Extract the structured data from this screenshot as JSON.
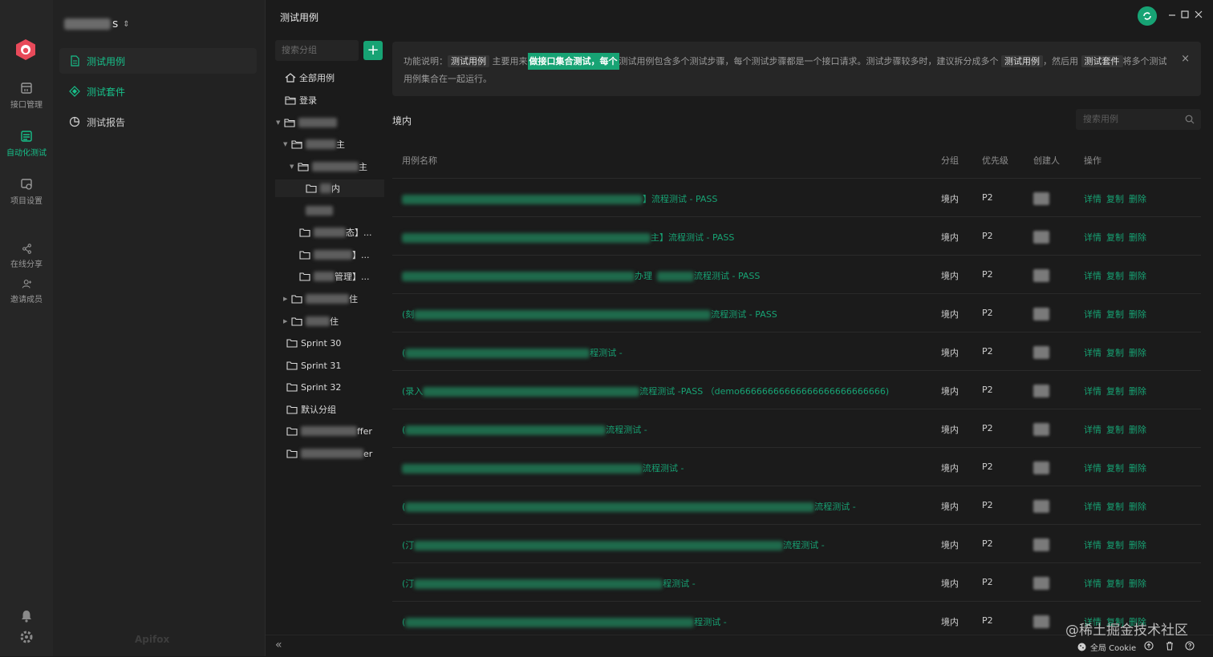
{
  "rail": {
    "items": [
      {
        "label": "接口管理"
      },
      {
        "label": "自动化测试"
      },
      {
        "label": "项目设置"
      },
      {
        "label": "在线分享"
      },
      {
        "label": "邀请成员"
      }
    ]
  },
  "nav": {
    "project_suffix": "s",
    "items": [
      {
        "label": "测试用例"
      },
      {
        "label": "测试套件"
      },
      {
        "label": "测试报告"
      }
    ],
    "footer": "Apifox"
  },
  "header": {
    "title": "测试用例"
  },
  "tree": {
    "search_placeholder": "搜索分组",
    "add_label": "+",
    "all_cases": "全部用例",
    "login": "登录",
    "sprints": [
      "Sprint 30",
      "Sprint 31",
      "Sprint 32"
    ],
    "default_group": "默认分组",
    "partials": {
      "n3": "主",
      "n4": "主",
      "n5": "内",
      "n7": "态】...",
      "n8": "】...",
      "n9": "管理】...",
      "n10": "住",
      "n11": "住",
      "n12": "ffer",
      "n13": "er"
    }
  },
  "tip": {
    "prefix": "功能说明：",
    "tag1": "测试用例",
    "t1": "主要用来",
    "highlight": "做接口集合测试，每个",
    "t2": "测试用例包含多个测试步骤，每个测试步骤都是一个接口请求。测试步骤较多时，建议拆分成多个",
    "tag2": "测试用例",
    "t3": "，然后用",
    "tag3": "测试套件",
    "t4": "将多个测试",
    "line2": "用例集合在一起运行。",
    "close": "×"
  },
  "group_title": "境内",
  "case_search_placeholder": "搜索用例",
  "table": {
    "headers": {
      "name": "用例名称",
      "group": "分组",
      "priority": "优先级",
      "owner": "创建人",
      "ops": "操作"
    },
    "ops": {
      "detail": "详情",
      "copy": "复制",
      "delete": "删除"
    },
    "rows": [
      {
        "prefix": "",
        "tail": "】流程测试 - PASS",
        "group": "境内",
        "priority": "P2"
      },
      {
        "prefix": "",
        "tail": "主】流程测试 - PASS",
        "group": "境内",
        "priority": "P2"
      },
      {
        "prefix": "",
        "tail": "办理",
        "tail2": "流程测试 - PASS",
        "group": "境内",
        "priority": "P2"
      },
      {
        "prefix": "(刻",
        "tail": "流程测试 - PASS",
        "group": "境内",
        "priority": "P2"
      },
      {
        "prefix": "(",
        "tail": "程测试 -",
        "group": "境内",
        "priority": "P2"
      },
      {
        "prefix": "(录入",
        "tail": "流程测试 -PASS （demo66666666666666666666666666)",
        "group": "境内",
        "priority": "P2"
      },
      {
        "prefix": "(",
        "tail": "流程测试 -",
        "group": "境内",
        "priority": "P2"
      },
      {
        "prefix": "",
        "tail": "流程测试 -",
        "group": "境内",
        "priority": "P2"
      },
      {
        "prefix": "(",
        "tail": "流程测试 -",
        "group": "境内",
        "priority": "P2"
      },
      {
        "prefix": "(汀",
        "tail": "流程测试 -",
        "group": "境内",
        "priority": "P2"
      },
      {
        "prefix": "(汀",
        "tail": "程测试 -",
        "group": "境内",
        "priority": "P2"
      },
      {
        "prefix": "(",
        "tail": "程测试 -",
        "group": "境内",
        "priority": "P2"
      }
    ]
  },
  "statusbar": {
    "collapse": "«",
    "cookie": "全局 Cookie"
  },
  "watermark": "@稀土掘金技术社区",
  "colors": {
    "accent": "#17a374",
    "accent_text": "#17c08a",
    "bg": "#1b1b1b",
    "sidebar": "#222222",
    "rail": "#262626"
  }
}
